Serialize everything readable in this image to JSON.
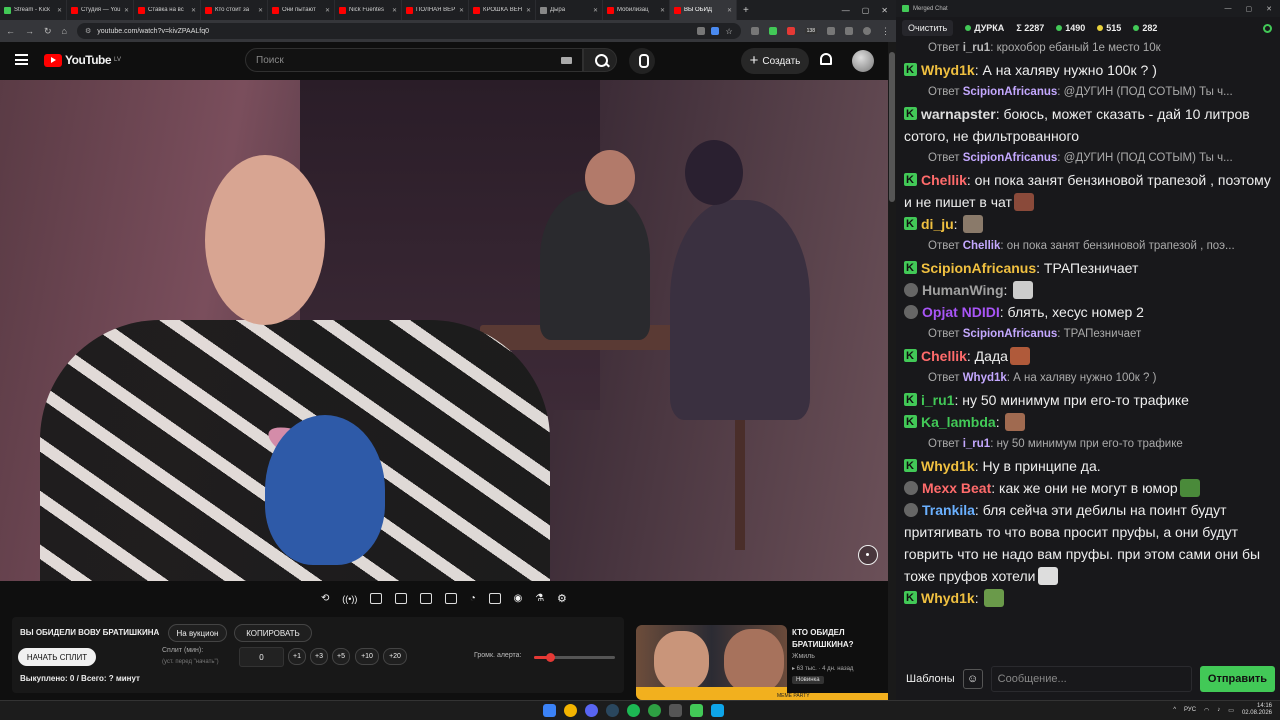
{
  "browser": {
    "tabs": [
      {
        "label": "Stream - Kick",
        "color": "#42c957"
      },
      {
        "label": "Студия — YouTube",
        "color": "#ff0000"
      },
      {
        "label": "Ставка на вс",
        "color": "#ff0000"
      },
      {
        "label": "Кто стоит за",
        "color": "#ff0000"
      },
      {
        "label": "Они пытают",
        "color": "#ff0000"
      },
      {
        "label": "Nick Fuentes",
        "color": "#ff0000"
      },
      {
        "label": "ПОЛНАЯ ВЕР",
        "color": "#ff0000"
      },
      {
        "label": "КРОШКА ВЕН",
        "color": "#ff0000"
      },
      {
        "label": "Дыра",
        "color": "#888888"
      },
      {
        "label": "Мобилизац",
        "color": "#ff0000"
      },
      {
        "label": "ВЫ ОБИД",
        "color": "#ff0000",
        "active": true
      }
    ],
    "new_tab": "+",
    "url": "youtube.com/watch?v=kivZPAALfq0",
    "extension_badge": "138"
  },
  "youtube": {
    "logo_text": "YouTube",
    "logo_region": "LV",
    "search_placeholder": "Поиск",
    "create_label": "Создать"
  },
  "auction_panel": {
    "title": "ВЫ ОБИДЕЛИ ВОВУ БРАТИШКИНА",
    "auction_button": "На вукцион",
    "copy_button": "КОПИРОВАТЬ",
    "start_split_button": "НАЧАТЬ СПЛИТ",
    "split_label": "Сплит (мин):",
    "split_hint": "(уст. перед \"начать\")",
    "split_value": "0",
    "increments": [
      "+1",
      "+3",
      "+5",
      "+10",
      "+20"
    ],
    "bought_text": "Выкуплено: 0 / Всего: ? минут",
    "volume_label": "Громк. алерта:",
    "volume_level": 0.2
  },
  "recommendation": {
    "title": "КТО ОБИДЕЛ БРАТИШКИНА?",
    "channel": "Жмиль",
    "meta": "▸ 63 тыс. · 4 дн. назад",
    "badge": "Новинка",
    "banner": "MEME PARTY"
  },
  "chat": {
    "window_title": "Merged Chat",
    "clear_label": "Очистить",
    "channel_name": "ДУРКА",
    "stats": [
      {
        "value": "Σ 2287",
        "color": "#ffffff"
      },
      {
        "value": "1490",
        "color": "#42c957"
      },
      {
        "value": "515",
        "color": "#e8d13b"
      },
      {
        "value": "282",
        "color": "#42c957"
      }
    ],
    "templates_label": "Шаблоны",
    "input_placeholder": "Сообщение...",
    "send_label": "Отправить"
  },
  "messages": [
    {
      "type": "reply",
      "prefix": "Ответ",
      "nick": "i_ru1",
      "nick_color": "#bbbbbb",
      "text": ": крохобор ебаный 1е место 10к"
    },
    {
      "type": "msg",
      "platform": "kick",
      "nick": "Whyd1k",
      "nick_color": "#f0c040",
      "text": ": А на халяву нужно 100к ? )"
    },
    {
      "type": "reply",
      "prefix": "Ответ",
      "nick": "ScipionAfricanus",
      "nick_color": "#c4a8ff",
      "text": ": @ДУГИН (ПОД СОТЫМ)  Ты ч..."
    },
    {
      "type": "msg",
      "platform": "kick",
      "nick": "warnapster",
      "nick_color": "#dddddd",
      "text": ": боюсь, может сказать - дай 10 литров сотого, не фильтрованного"
    },
    {
      "type": "reply",
      "prefix": "Ответ",
      "nick": "ScipionAfricanus",
      "nick_color": "#c4a8ff",
      "text": ": @ДУГИН (ПОД СОТЫМ)  Ты ч..."
    },
    {
      "type": "msg",
      "platform": "kick",
      "nick": "Chellik",
      "nick_color": "#ff6b6b",
      "text": ": он пока занят бензиновой трапезой , поэтому и не пишет в чат",
      "emote": "#8a4a3a"
    },
    {
      "type": "msg",
      "platform": "kick",
      "nick": "di_ju",
      "nick_color": "#f0c040",
      "text": ": ",
      "emote": "#8a7a6a"
    },
    {
      "type": "reply",
      "prefix": "Ответ",
      "nick": "Chellik",
      "nick_color": "#c4a8ff",
      "text": ": он пока занят бензиновой трапезой , поэ..."
    },
    {
      "type": "msg",
      "platform": "kick",
      "nick": "ScipionAfricanus",
      "nick_color": "#f0c040",
      "text": ": ТРАПезничает"
    },
    {
      "type": "msg",
      "platform": "yt",
      "nick": "HumanWing",
      "nick_color": "#a0a0a0",
      "text": ": ",
      "emote": "#cccccc"
    },
    {
      "type": "msg",
      "platform": "yt",
      "nick": "Opjat NDIDI",
      "nick_color": "#a855f7",
      "text": ": блять, хесус номер 2"
    },
    {
      "type": "reply",
      "prefix": "Ответ",
      "nick": "ScipionAfricanus",
      "nick_color": "#c4a8ff",
      "text": ": ТРАПезничает"
    },
    {
      "type": "msg",
      "platform": "kick",
      "nick": "Chellik",
      "nick_color": "#ff6b6b",
      "text": ": Дада",
      "emote": "#b05a3a"
    },
    {
      "type": "reply",
      "prefix": "Ответ",
      "nick": "Whyd1k",
      "nick_color": "#c4a8ff",
      "text": ": А на халяву нужно 100к ? )"
    },
    {
      "type": "msg",
      "platform": "kick",
      "nick": "i_ru1",
      "nick_color": "#42c957",
      "text": ": ну 50 минимум при его-то трафике"
    },
    {
      "type": "msg",
      "platform": "kick",
      "nick": "Ka_lambda",
      "nick_color": "#42c957",
      "text": ": ",
      "emote": "#a06a50"
    },
    {
      "type": "reply",
      "prefix": "Ответ",
      "nick": "i_ru1",
      "nick_color": "#c4a8ff",
      "text": ": ну 50 минимум при его-то трафике"
    },
    {
      "type": "msg",
      "platform": "kick",
      "nick": "Whyd1k",
      "nick_color": "#f0c040",
      "text": ": Ну в принципе да."
    },
    {
      "type": "msg",
      "platform": "yt",
      "nick": "Mexx Beat",
      "nick_color": "#ff6b6b",
      "text": ": как же они не могут в юмор",
      "emote": "#4a8a3a"
    },
    {
      "type": "msg",
      "platform": "yt",
      "nick": "Trankila",
      "nick_color": "#6ab0ff",
      "text": ": бля сейча  эти дебилы на поинт будут притягивать то что вова просит пруфы, а они будут говрить что не надо вам пруфы. при этом сами они бы тоже пруфов хотели",
      "emote": "#dddddd"
    },
    {
      "type": "msg",
      "platform": "kick",
      "nick": "Whyd1k",
      "nick_color": "#f0c040",
      "text": ": ",
      "emote": "#6a9a4a"
    }
  ],
  "taskbar": {
    "lang": "РУС",
    "time": "14:16",
    "date": "02.08.2026"
  }
}
